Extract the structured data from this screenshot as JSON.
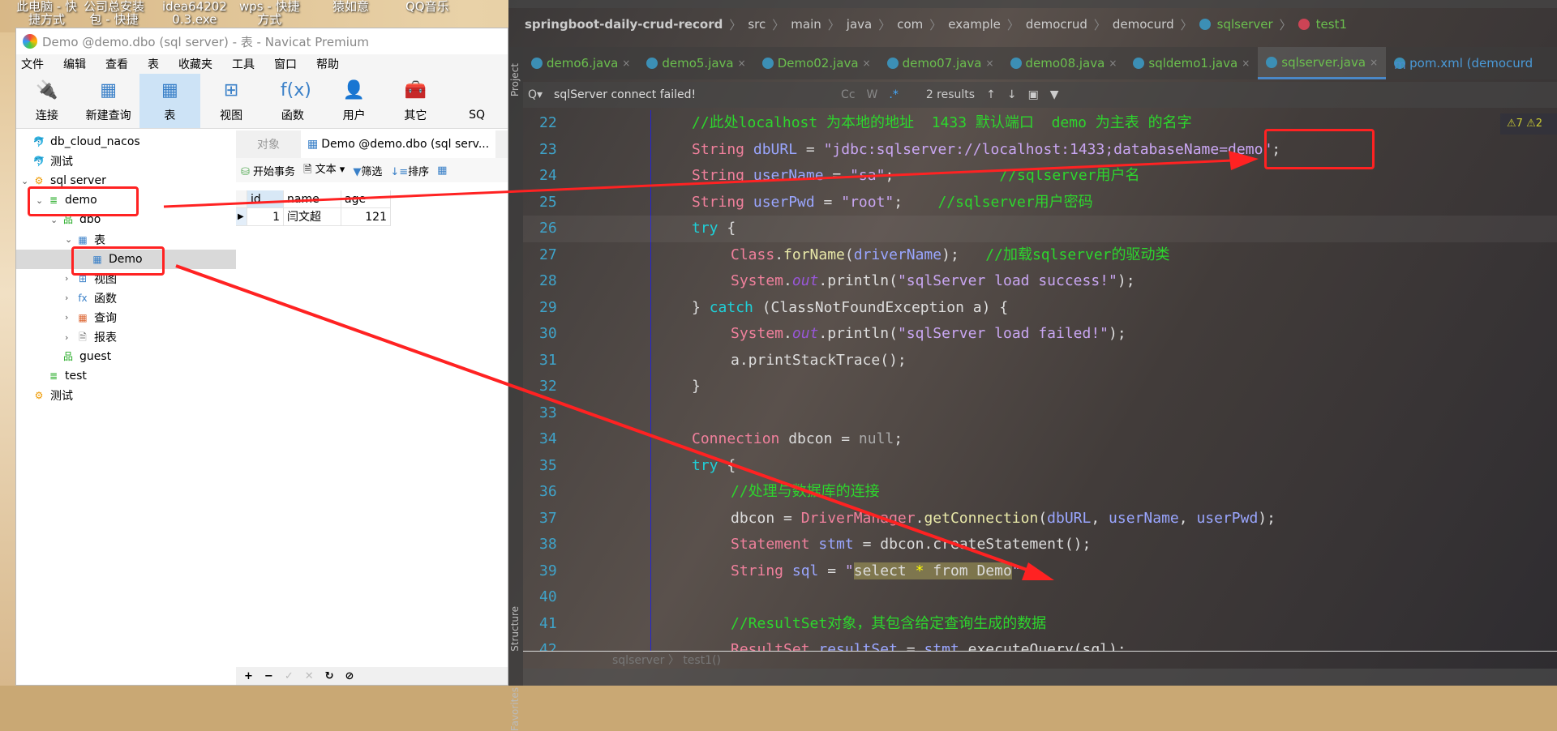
{
  "desktop": {
    "icons": [
      [
        "此电脑 - 快",
        "捷方式"
      ],
      [
        "公司总安装",
        "包 - 快捷"
      ],
      [
        "idea64202",
        "0.3.exe"
      ],
      [
        "wps - 快捷",
        "方式"
      ],
      [
        "猿如意",
        ""
      ],
      [
        "QQ音乐",
        ""
      ]
    ]
  },
  "navicat": {
    "title": "Demo @demo.dbo (sql server) - 表 - Navicat Premium",
    "menu": [
      "文件",
      "编辑",
      "查看",
      "表",
      "收藏夹",
      "工具",
      "窗口",
      "帮助"
    ],
    "toolbar": [
      {
        "label": "连接",
        "icon": "plug-icon"
      },
      {
        "label": "新建查询",
        "icon": "new-query-icon"
      },
      {
        "label": "表",
        "icon": "table-icon",
        "active": true
      },
      {
        "label": "视图",
        "icon": "view-icon"
      },
      {
        "label": "函数",
        "icon": "function-icon"
      },
      {
        "label": "用户",
        "icon": "user-icon"
      },
      {
        "label": "其它",
        "icon": "tools-icon"
      },
      {
        "label": "SQ",
        "icon": ""
      }
    ],
    "tree": [
      {
        "label": "db_cloud_nacos",
        "level": 0,
        "icon": "mysql-icon"
      },
      {
        "label": "测试",
        "level": 0,
        "icon": "mysql-icon"
      },
      {
        "label": "sql server",
        "level": 0,
        "icon": "sqlserver-icon",
        "expanded": true
      },
      {
        "label": "demo",
        "level": 1,
        "icon": "database-icon",
        "expanded": true
      },
      {
        "label": "dbo",
        "level": 2,
        "icon": "schema-icon",
        "expanded": true
      },
      {
        "label": "表",
        "level": 3,
        "icon": "table-icon",
        "expanded": true
      },
      {
        "label": "Demo",
        "level": 4,
        "icon": "table-icon",
        "selected": true
      },
      {
        "label": "视图",
        "level": 3,
        "icon": "view-icon",
        "collapsed": true
      },
      {
        "label": "函数",
        "level": 3,
        "icon": "function-icon",
        "collapsed": true
      },
      {
        "label": "查询",
        "level": 3,
        "icon": "query-icon",
        "collapsed": true
      },
      {
        "label": "报表",
        "level": 3,
        "icon": "report-icon",
        "collapsed": true
      },
      {
        "label": "guest",
        "level": 2,
        "icon": "schema-icon"
      },
      {
        "label": "test",
        "level": 1,
        "icon": "database-icon"
      },
      {
        "label": "测试",
        "level": 0,
        "icon": "sqlserver-icon"
      }
    ],
    "tabs": {
      "objects": "对象",
      "table": "Demo @demo.dbo (sql serv..."
    },
    "table_toolbar": {
      "begin": "开始事务",
      "text": "文本",
      "filter": "筛选",
      "sort": "排序"
    },
    "grid": {
      "columns": [
        "id",
        "name",
        "age"
      ],
      "rows": [
        [
          "1",
          "闫文超",
          "121"
        ]
      ]
    },
    "bottom_buttons": [
      "+",
      "−",
      "✓",
      "✕",
      "↻",
      "⊘"
    ]
  },
  "ide": {
    "breadcrumb": [
      "springboot-daily-crud-record",
      "src",
      "main",
      "java",
      "com",
      "example",
      "democrud",
      "democurd",
      "sqlserver",
      "test1"
    ],
    "tabs": [
      {
        "label": "demo6.java"
      },
      {
        "label": "demo5.java"
      },
      {
        "label": "Demo02.java"
      },
      {
        "label": "demo07.java"
      },
      {
        "label": "demo08.java"
      },
      {
        "label": "sqldemo1.java"
      },
      {
        "label": "sqlserver.java",
        "active": true
      },
      {
        "label": "pom.xml (democurd"
      }
    ],
    "find": {
      "query": "sqlServer connect failed!",
      "results": "2 results"
    },
    "warnings": {
      "warn": "7",
      "weak": "2"
    },
    "side_tabs": {
      "project": "Project",
      "structure": "Structure",
      "favorites": "Favorites"
    },
    "bottom_breadcrumb": "sqlserver 〉 test1()",
    "lines": [
      {
        "n": "22",
        "i": 2,
        "t": [
          [
            "//此处localhost 为本地的地址  1433 默认端口  demo 为主表 的名字",
            "com"
          ]
        ]
      },
      {
        "n": "23",
        "i": 2,
        "t": [
          [
            "String ",
            "type"
          ],
          [
            "dbURL",
            "var"
          ],
          [
            " = ",
            "p"
          ],
          [
            "\"jdbc:sqlserver://localhost:1433;databaseName=demo\"",
            "str"
          ],
          [
            ";",
            "p"
          ]
        ]
      },
      {
        "n": "24",
        "i": 2,
        "t": [
          [
            "String ",
            "type"
          ],
          [
            "userName",
            "var"
          ],
          [
            " = ",
            "p"
          ],
          [
            "\"sa\"",
            "str"
          ],
          [
            ";            ",
            "p"
          ],
          [
            "//sqlserver用户名",
            "com"
          ]
        ]
      },
      {
        "n": "25",
        "i": 2,
        "t": [
          [
            "String ",
            "type"
          ],
          [
            "userPwd",
            "var"
          ],
          [
            " = ",
            "p"
          ],
          [
            "\"root\"",
            "str"
          ],
          [
            ";    ",
            "p"
          ],
          [
            "//sqlserver用户密码",
            "com"
          ]
        ]
      },
      {
        "n": "26",
        "i": 2,
        "t": [
          [
            "try ",
            "kw"
          ],
          [
            "{",
            "p"
          ]
        ],
        "cur": true
      },
      {
        "n": "27",
        "i": 3,
        "t": [
          [
            "Class",
            "type"
          ],
          [
            ".",
            "p"
          ],
          [
            "forName",
            "meth"
          ],
          [
            "(",
            "p"
          ],
          [
            "driverName",
            "var"
          ],
          [
            ");   ",
            "p"
          ],
          [
            "//加载sqlserver的驱动类",
            "com"
          ]
        ]
      },
      {
        "n": "28",
        "i": 3,
        "t": [
          [
            "System",
            "type"
          ],
          [
            ".",
            "p"
          ],
          [
            "out",
            "out"
          ],
          [
            ".println(",
            "p"
          ],
          [
            "\"sqlServer load success!\"",
            "str"
          ],
          [
            ");",
            "p"
          ]
        ]
      },
      {
        "n": "29",
        "i": 2,
        "t": [
          [
            "} ",
            "p"
          ],
          [
            "catch ",
            "kw"
          ],
          [
            "(ClassNotFoundException a) {",
            "p"
          ]
        ]
      },
      {
        "n": "30",
        "i": 3,
        "t": [
          [
            "System",
            "type"
          ],
          [
            ".",
            "p"
          ],
          [
            "out",
            "out"
          ],
          [
            ".println(",
            "p"
          ],
          [
            "\"sqlServer load failed!\"",
            "str"
          ],
          [
            ");",
            "p"
          ]
        ]
      },
      {
        "n": "31",
        "i": 3,
        "t": [
          [
            "a.printStackTrace();",
            "p"
          ]
        ]
      },
      {
        "n": "32",
        "i": 2,
        "t": [
          [
            "}",
            "p"
          ]
        ]
      },
      {
        "n": "33",
        "i": 2,
        "t": []
      },
      {
        "n": "34",
        "i": 2,
        "t": [
          [
            "Connection ",
            "type"
          ],
          [
            "dbcon",
            "p"
          ],
          [
            " = ",
            "p"
          ],
          [
            "null",
            "lit"
          ],
          [
            ";",
            "p"
          ]
        ]
      },
      {
        "n": "35",
        "i": 2,
        "t": [
          [
            "try ",
            "kw"
          ],
          [
            "{",
            "p"
          ]
        ]
      },
      {
        "n": "36",
        "i": 3,
        "t": [
          [
            "//处理与数据库的连接",
            "com"
          ]
        ]
      },
      {
        "n": "37",
        "i": 3,
        "t": [
          [
            "dbcon",
            "p"
          ],
          [
            " = ",
            "p"
          ],
          [
            "DriverManager",
            "type"
          ],
          [
            ".",
            "p"
          ],
          [
            "getConnection",
            "meth"
          ],
          [
            "(",
            "p"
          ],
          [
            "dbURL",
            "var"
          ],
          [
            ", ",
            "p"
          ],
          [
            "userName",
            "var"
          ],
          [
            ", ",
            "p"
          ],
          [
            "userPwd",
            "var"
          ],
          [
            ");",
            "p"
          ]
        ]
      },
      {
        "n": "38",
        "i": 3,
        "t": [
          [
            "Statement ",
            "type"
          ],
          [
            "stmt",
            "var"
          ],
          [
            " = ",
            "p"
          ],
          [
            "dbcon",
            "p"
          ],
          [
            ".createStatement();",
            "p"
          ]
        ]
      },
      {
        "n": "39",
        "i": 3,
        "t": [
          [
            "String ",
            "type"
          ],
          [
            "sql",
            "var"
          ],
          [
            " = ",
            "p"
          ],
          [
            "\"",
            "str"
          ],
          [
            "select ",
            "hl"
          ],
          [
            "*",
            "star"
          ],
          [
            " from Demo",
            "hl"
          ],
          [
            "\"",
            "str"
          ],
          [
            ";",
            "p"
          ]
        ]
      },
      {
        "n": "40",
        "i": 3,
        "t": []
      },
      {
        "n": "41",
        "i": 3,
        "t": [
          [
            "//ResultSet对象，其包含给定查询生成的数据",
            "com"
          ]
        ]
      },
      {
        "n": "42",
        "i": 3,
        "t": [
          [
            "ResultSet ",
            "type"
          ],
          [
            "resultSet",
            "var"
          ],
          [
            " = ",
            "p"
          ],
          [
            "stmt",
            "var"
          ],
          [
            ".executeQuery(sql);",
            "p"
          ]
        ]
      }
    ]
  },
  "annotation_color": "#ff2222"
}
